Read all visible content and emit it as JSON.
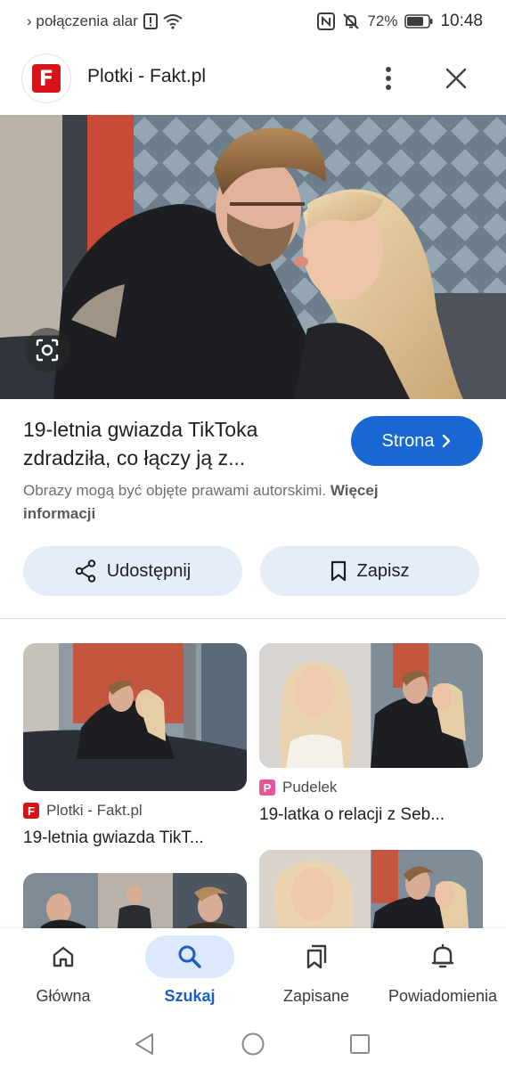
{
  "status_bar": {
    "notification_text": "› połączenia alar",
    "battery": "72%",
    "time": "10:48"
  },
  "header": {
    "site_title": "Plotki - Fakt.pl",
    "logo_letter": "F"
  },
  "result": {
    "headline_line1": "19-letnia gwiazda TikToka",
    "headline_line2": "zdradziła, co łączy ją z...",
    "visit_label": "Strona",
    "copyright_text": "Obrazy mogą być objęte prawami autorskimi. ",
    "copyright_link_1": "Więcej",
    "copyright_link_2": "informacji"
  },
  "actions": {
    "share_label": "Udostępnij",
    "save_label": "Zapisz"
  },
  "related": [
    {
      "source": "Plotki - Fakt.pl",
      "source_letter": "F",
      "title": "19-letnia gwiazda TikT..."
    },
    {
      "source": "Pudelek",
      "source_letter": "P",
      "title": "19-latka o relacji z Seb..."
    }
  ],
  "bottom_nav": {
    "items": [
      {
        "label": "Główna",
        "icon": "home-icon"
      },
      {
        "label": "Szukaj",
        "icon": "search-icon"
      },
      {
        "label": "Zapisane",
        "icon": "bookmarks-icon"
      },
      {
        "label": "Powiadomienia",
        "icon": "bell-icon"
      }
    ],
    "active_index": 1
  },
  "colors": {
    "accent": "#1967d2",
    "button_bg": "#e5edf8",
    "fakt_red": "#d7141a",
    "pudelek_pink": "#e4559b"
  }
}
